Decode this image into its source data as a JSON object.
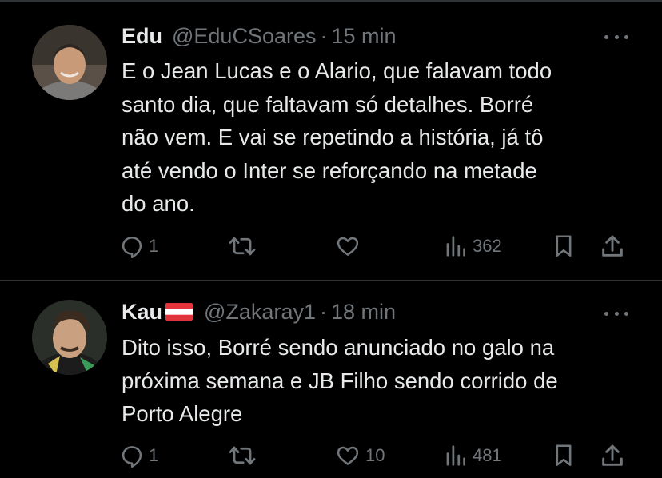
{
  "tweets": [
    {
      "name": "Edu",
      "handle": "@EduCSoares",
      "separator": "·",
      "time": "15 min",
      "lines": [
        "E o Jean Lucas e o Alario, que falavam todo",
        "santo dia, que faltavam só detalhes. Borré",
        "não vem. E vai se repetindo a história, já tô",
        "até vendo o Inter se reforçando na metade",
        "do ano."
      ],
      "replies": "1",
      "retweets": "",
      "likes": "",
      "views": "362"
    },
    {
      "name": "Kau",
      "handle": "@Zakaray1",
      "separator": "·",
      "time": "18 min",
      "lines": [
        "Dito isso, Borré sendo anunciado no galo na",
        "próxima semana e JB Filho sendo corrido de",
        "Porto Alegre"
      ],
      "replies": "1",
      "retweets": "",
      "likes": "10",
      "views": "481"
    }
  ],
  "icons": {
    "reply": "reply-icon",
    "retweet": "retweet-icon",
    "like": "heart-icon",
    "views": "views-icon",
    "bookmark": "bookmark-icon",
    "share": "share-icon",
    "more": "more-icon",
    "flag": "austria-flag-icon"
  },
  "colors": {
    "background": "#000000",
    "text": "#e7e9ea",
    "secondary": "#71767b",
    "divider": "#2f3336",
    "flag_red": "#e2323c"
  }
}
